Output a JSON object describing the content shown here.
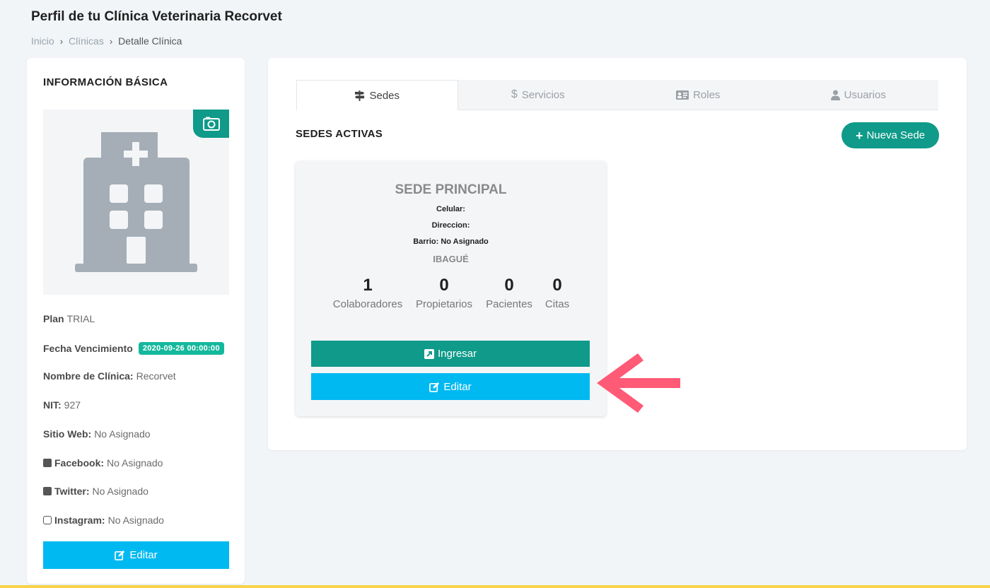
{
  "header": {
    "title": "Perfil de tu Clínica Veterinaria Recorvet",
    "breadcrumb": [
      "Inicio",
      "Clínicas",
      "Detalle Clínica"
    ]
  },
  "basic_info": {
    "title": "INFORMACIÓN BÁSICA",
    "plan_label": "Plan",
    "plan_value": "TRIAL",
    "expiry_label": "Fecha Vencimiento",
    "expiry_value": "2020-09-26 00:00:00",
    "clinic_name_label": "Nombre de Clínica:",
    "clinic_name_value": "Recorvet",
    "nit_label": "NIT:",
    "nit_value": "927",
    "website_label": "Sitio Web:",
    "website_value": "No Asignado",
    "facebook_label": "Facebook:",
    "facebook_value": "No Asignado",
    "twitter_label": "Twitter:",
    "twitter_value": "No Asignado",
    "instagram_label": "Instagram:",
    "instagram_value": "No Asignado",
    "edit_label": "Editar"
  },
  "tabs": [
    {
      "label": "Sedes",
      "icon": "signpost-icon",
      "active": true
    },
    {
      "label": "Servicios",
      "icon": "dollar-icon",
      "active": false
    },
    {
      "label": "Roles",
      "icon": "id-card-icon",
      "active": false
    },
    {
      "label": "Usuarios",
      "icon": "user-doctor-icon",
      "active": false
    }
  ],
  "sedes": {
    "title": "SEDES ACTIVAS",
    "new_label": "Nueva Sede",
    "card": {
      "name": "SEDE PRINCIPAL",
      "celular": "Celular:",
      "direccion": "Direccion:",
      "barrio": "Barrio: No Asignado",
      "city": "IBAGUÉ",
      "stats": [
        {
          "value": "1",
          "label": "Colaboradores"
        },
        {
          "value": "0",
          "label": "Propietarios"
        },
        {
          "value": "0",
          "label": "Pacientes"
        },
        {
          "value": "0",
          "label": "Citas"
        }
      ],
      "enter_label": "Ingresar",
      "edit_label": "Editar"
    }
  },
  "colors": {
    "primary_green": "#0f9a89",
    "edit_blue": "#00b9f1",
    "badge_green": "#14b89c",
    "arrow_pink": "#ff5a76"
  }
}
